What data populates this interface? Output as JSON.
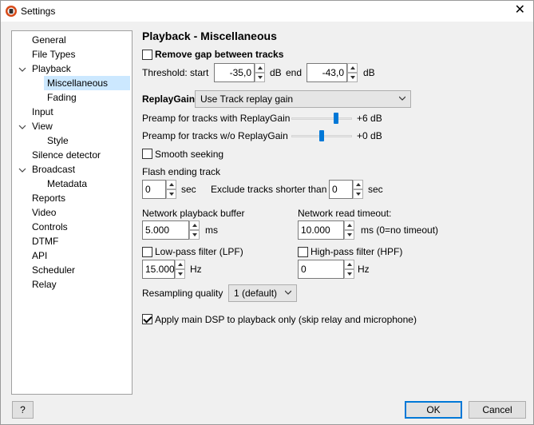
{
  "window": {
    "title": "Settings",
    "close_glyph": "✕"
  },
  "sidebar": {
    "items": [
      {
        "label": "General"
      },
      {
        "label": "File Types"
      },
      {
        "label": "Playback"
      },
      {
        "label": "Miscellaneous"
      },
      {
        "label": "Fading"
      },
      {
        "label": "Input"
      },
      {
        "label": "View"
      },
      {
        "label": "Style"
      },
      {
        "label": "Silence detector"
      },
      {
        "label": "Broadcast"
      },
      {
        "label": "Metadata"
      },
      {
        "label": "Reports"
      },
      {
        "label": "Video"
      },
      {
        "label": "Controls"
      },
      {
        "label": "DTMF"
      },
      {
        "label": "API"
      },
      {
        "label": "Scheduler"
      },
      {
        "label": "Relay"
      }
    ]
  },
  "page": {
    "heading": "Playback - Miscellaneous",
    "remove_gap": {
      "label": "Remove gap between tracks",
      "checked": false
    },
    "threshold": {
      "label": "Threshold:",
      "start_label": "start",
      "start_value": "-35,0",
      "db1": "dB",
      "end_label": "end",
      "end_value": "-43,0",
      "db2": "dB"
    },
    "replaygain": {
      "label": "ReplayGain",
      "selected": "Use Track replay gain"
    },
    "preamp_with": {
      "label": "Preamp for tracks with ReplayGain",
      "value_text": "+6 dB",
      "level": 0.75
    },
    "preamp_without": {
      "label": "Preamp for tracks w/o ReplayGain",
      "value_text": "+0 dB",
      "level": 0.5
    },
    "smooth_seeking": {
      "label": "Smooth seeking",
      "checked": false
    },
    "flash_ending": {
      "label": "Flash ending track",
      "value": "0",
      "unit": "sec",
      "exclude_label": "Exclude tracks shorter than",
      "exclude_value": "0",
      "exclude_unit": "sec"
    },
    "network_buffer": {
      "label": "Network playback buffer",
      "value": "5.000",
      "unit": "ms"
    },
    "network_timeout": {
      "label": "Network read timeout:",
      "value": "10.000",
      "unit": "ms (0=no timeout)"
    },
    "lpf": {
      "label": "Low-pass filter (LPF)",
      "checked": false,
      "value": "15.000",
      "unit": "Hz"
    },
    "hpf": {
      "label": "High-pass filter (HPF)",
      "checked": false,
      "value": "0",
      "unit": "Hz"
    },
    "resampling": {
      "label": "Resampling quality",
      "selected": "1 (default)"
    },
    "apply_dsp": {
      "label": "Apply main DSP to playback only (skip relay and microphone)",
      "checked": true
    }
  },
  "footer": {
    "help_label": "?",
    "ok_label": "OK",
    "cancel_label": "Cancel"
  },
  "colors": {
    "accent": "#0078d7",
    "selection": "#cce8ff",
    "app_icon": "#d64b1a"
  }
}
